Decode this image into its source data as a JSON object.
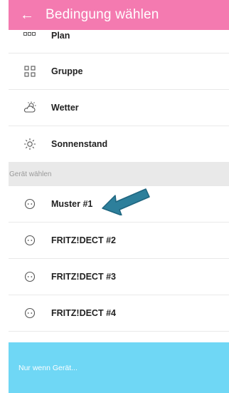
{
  "appbar": {
    "title": "Bedingung wählen",
    "back_icon": "arrow-left-icon"
  },
  "conditions": [
    {
      "label": "Plan",
      "icon": "plan-icon"
    },
    {
      "label": "Gruppe",
      "icon": "group-icon"
    },
    {
      "label": "Wetter",
      "icon": "weather-icon"
    },
    {
      "label": "Sonnenstand",
      "icon": "sun-icon"
    }
  ],
  "devices_section": {
    "header": "Gerät wählen"
  },
  "devices": [
    {
      "label": "Muster #1",
      "icon": "plug-icon"
    },
    {
      "label": "FRITZ!DECT #2",
      "icon": "plug-icon"
    },
    {
      "label": "FRITZ!DECT #3",
      "icon": "plug-icon"
    },
    {
      "label": "FRITZ!DECT #4",
      "icon": "plug-icon"
    }
  ],
  "footer": {
    "text": "Nur wenn Gerät..."
  },
  "colors": {
    "appbar": "#f47ab0",
    "footer": "#6fd7f5",
    "arrow": "#2d7f9b",
    "section": "#e9e9e9"
  }
}
